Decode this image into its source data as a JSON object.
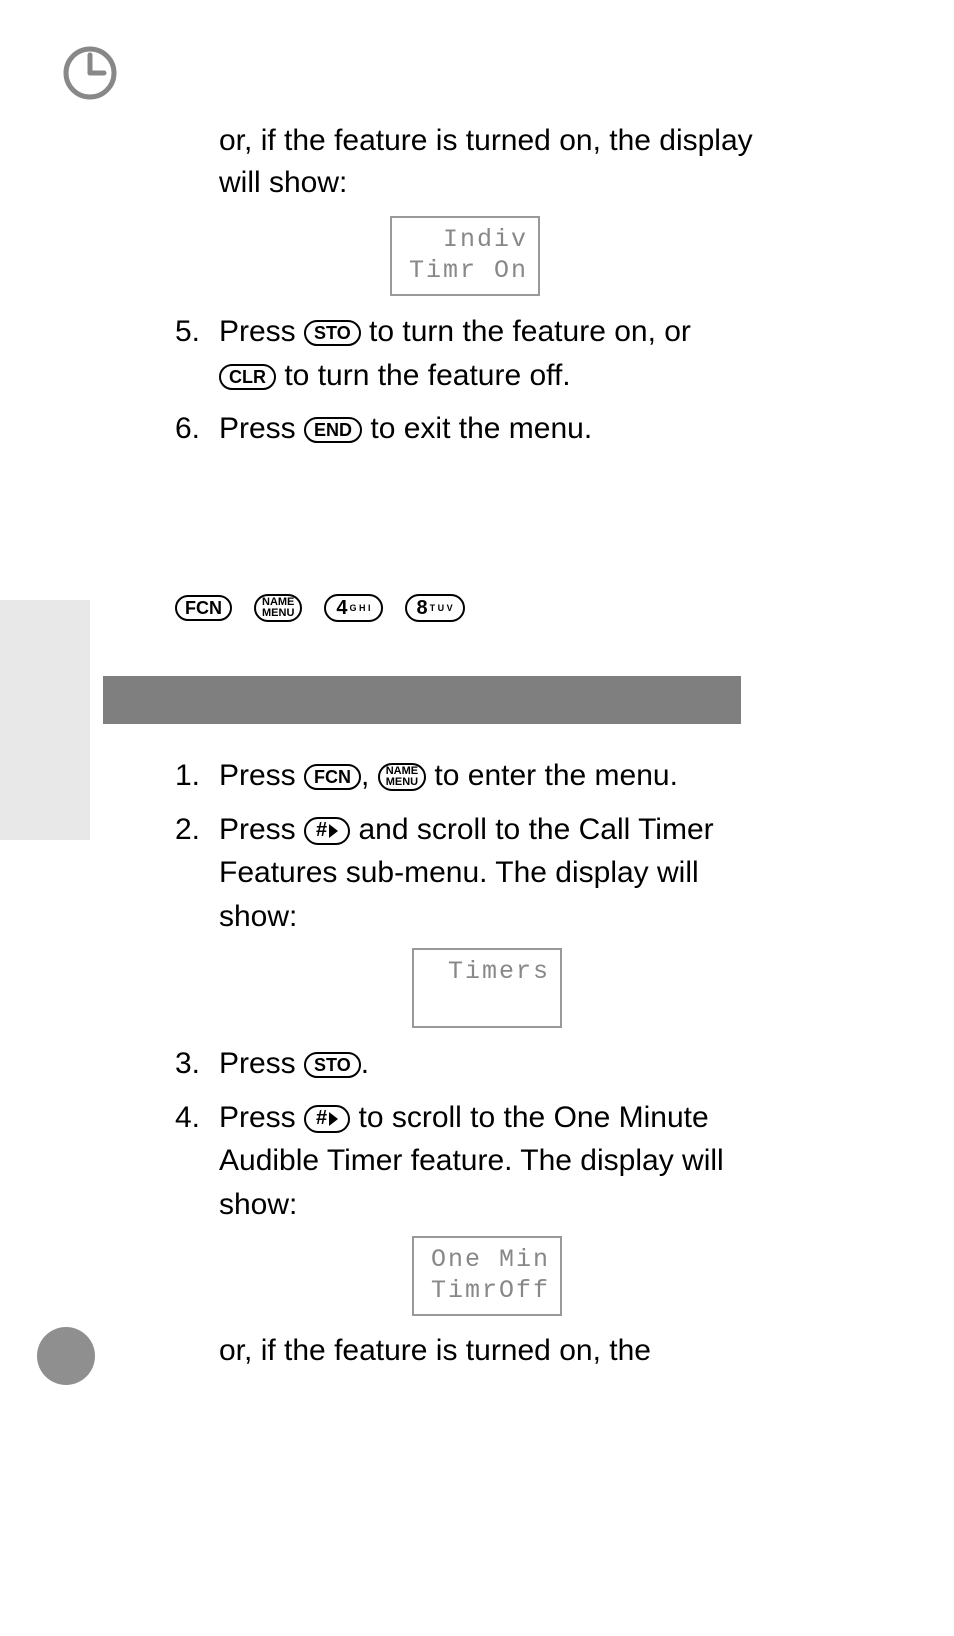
{
  "top": {
    "intro_para": "or, if the feature is turned on, the display will show:",
    "lcd1_line1": "Indiv",
    "lcd1_line2": "Timr On",
    "step5_num": "5.",
    "step5_a": "Press ",
    "step5_b": " to turn the feature on, or ",
    "step5_c": " to turn the feature off.",
    "step6_num": "6.",
    "step6_a": "Press ",
    "step6_b": " to exit the menu."
  },
  "keys": {
    "STO": "STO",
    "CLR": "CLR",
    "END": "END",
    "FCN": "FCN",
    "NAME": "NAME",
    "MENU": "MENU",
    "four": "4",
    "four_sup": "G\nH\nI",
    "eight": "8",
    "eight_sup": "T\nU\nV",
    "hash": "#"
  },
  "bottom": {
    "step1_num": "1.",
    "step1_a": "Press ",
    "step1_b": ", ",
    "step1_c": " to enter the menu.",
    "step2_num": "2.",
    "step2_a": "Press ",
    "step2_b": " and scroll to the Call Timer Features sub-menu. The display will show:",
    "lcd2_line1": "Timers",
    "step3_num": "3.",
    "step3_a": "Press ",
    "step3_b": ".",
    "step4_num": "4.",
    "step4_a": "Press ",
    "step4_b": " to scroll to the One Minute Audible Timer feature. The display will show:",
    "lcd3_line1": "One Min",
    "lcd3_line2": "TimrOff",
    "trailing_para": "or, if the feature is turned on, the"
  }
}
